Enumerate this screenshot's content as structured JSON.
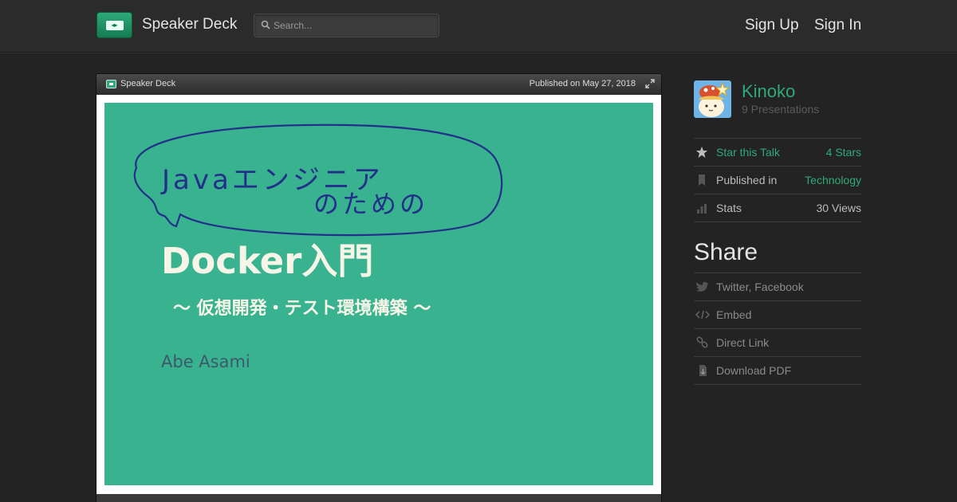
{
  "header": {
    "brand": "Speaker Deck",
    "search_placeholder": "Search...",
    "sign_up": "Sign Up",
    "sign_in": "Sign In"
  },
  "player": {
    "brand": "Speaker Deck",
    "published": "Published on May 27, 2018"
  },
  "slide": {
    "handwritten_line1": "Javaエンジニア",
    "handwritten_line2": "のための",
    "title": "Docker入門",
    "subtitle": "〜 仮想開発・テスト環境構築 〜",
    "author": "Abe Asami"
  },
  "author": {
    "name": "Kinoko",
    "presentations": "9 Presentations"
  },
  "stats": {
    "star_label": "Star this Talk",
    "star_value": "4 Stars",
    "published_label": "Published in",
    "published_value": "Technology",
    "stats_label": "Stats",
    "stats_value": "30 Views"
  },
  "share": {
    "title": "Share",
    "items": [
      "Twitter, Facebook",
      "Embed",
      "Direct Link",
      "Download PDF"
    ]
  },
  "colors": {
    "accent": "#2fa97a",
    "slide_bg": "#38b28f",
    "page_bg": "#232323"
  }
}
